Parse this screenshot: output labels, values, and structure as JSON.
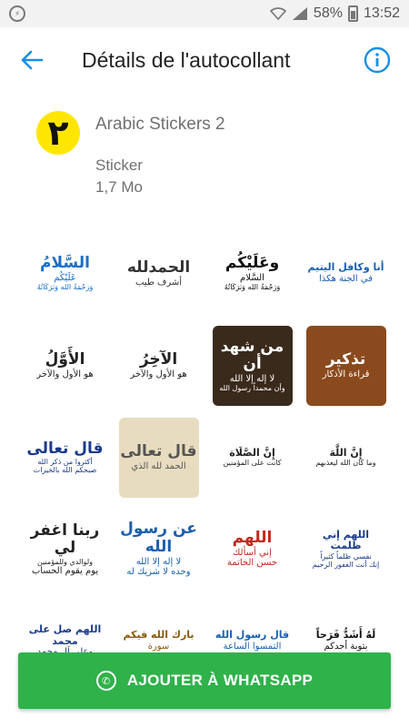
{
  "status_bar": {
    "battery": "58%",
    "time": "13:52"
  },
  "header": {
    "title": "Détails de l'autocollant"
  },
  "pack": {
    "logo_text": "٢",
    "name": "Arabic Stickers 2",
    "type": "Sticker",
    "size": "1,7 Mo"
  },
  "stickers": [
    {
      "lines": [
        "السَّلامُ",
        "عَلَيْكُم",
        "وَرَحْمَةُ الله وَبَرَكَاتُهُ"
      ],
      "color": "#1a6fc9",
      "bg": "#ffffff"
    },
    {
      "lines": [
        "الحمدلله",
        "أشرف طيب"
      ],
      "color": "#333333",
      "bg": "#ffffff"
    },
    {
      "lines": [
        "وعَلَيْكُم",
        "السَّلام",
        "وَرَحْمَةُ الله وَبَرَكَاتُهُ"
      ],
      "color": "#111111",
      "bg": "#ffffff"
    },
    {
      "lines": [
        "أنا وكافل اليتيم",
        "في الجنة هكذا"
      ],
      "color": "#1a5fb0",
      "bg": "#ffffff"
    },
    {
      "lines": [
        "الأَوَّلُ",
        "هو الأول والآخر"
      ],
      "color": "#222222",
      "bg": "#ffffff"
    },
    {
      "lines": [
        "الآخِرُ",
        "هو الأول والآخر"
      ],
      "color": "#222222",
      "bg": "#ffffff"
    },
    {
      "lines": [
        "من شهد أن",
        "لا إله إلا الله",
        "وأن محمداً رسول الله"
      ],
      "color": "#ffffff",
      "bg": "#3a2a1c"
    },
    {
      "lines": [
        "تذكير",
        "قراءة الأذكار"
      ],
      "color": "#ffffff",
      "bg": "#8a4a1e"
    },
    {
      "lines": [
        "قال تعالى",
        "أكثروا من ذكر الله",
        "صبحكم الله بالخيرات"
      ],
      "color": "#1a3a8a",
      "bg": "#ffffff"
    },
    {
      "lines": [
        "قال تعالى",
        "الحمد لله الذي"
      ],
      "color": "#555555",
      "bg": "#e8dcc0"
    },
    {
      "lines": [
        "إِنَّ الصَّلَاة",
        "كانت على المؤمنين"
      ],
      "color": "#222222",
      "bg": "#ffffff"
    },
    {
      "lines": [
        "إِنَّ اللَّهَ",
        "وما كان الله ليعذبهم"
      ],
      "color": "#222222",
      "bg": "#ffffff"
    },
    {
      "lines": [
        "ربنا اغفر لي",
        "ولوالدي وللمؤمنين",
        "يوم يقوم الحساب"
      ],
      "color": "#222222",
      "bg": "#ffffff"
    },
    {
      "lines": [
        "عن رسول الله",
        "لا إله إلا الله",
        "وحده لا شريك له"
      ],
      "color": "#1a5fb0",
      "bg": "#ffffff"
    },
    {
      "lines": [
        "اللهم",
        "إني أسألك",
        "حسن الخاتمة"
      ],
      "color": "#c0281e",
      "bg": "#ffffff"
    },
    {
      "lines": [
        "اللهم إني ظلمت",
        "نفسي ظلماً كثيراً",
        "إنك أنت الغفور الرحيم"
      ],
      "color": "#1a3a8a",
      "bg": "#ffffff"
    },
    {
      "lines": [
        "اللهم صل على محمد",
        "وعلى آل محمد"
      ],
      "color": "#1a3a8a",
      "bg": "#ffffff"
    },
    {
      "lines": [
        "بارك الله فيكم",
        "سورة"
      ],
      "color": "#8a5a10",
      "bg": "#ffffff"
    },
    {
      "lines": [
        "قال رسول الله",
        "التمسوا الساعة"
      ],
      "color": "#1a5fb0",
      "bg": "#ffffff"
    },
    {
      "lines": [
        "لَهُ أَشَدُّ فَرَحاً",
        "بتوبة أحدكم"
      ],
      "color": "#111111",
      "bg": "#ffffff"
    }
  ],
  "button": {
    "label": "AJOUTER À WHATSAPP"
  },
  "colors": {
    "accent_blue": "#1a8fe3",
    "button_green": "#2fb24a",
    "logo_yellow": "#ffe600"
  },
  "icons": [
    "messenger-icon",
    "wifi-icon",
    "signal-icon",
    "battery-icon",
    "back-arrow-icon",
    "info-icon",
    "whatsapp-icon"
  ]
}
